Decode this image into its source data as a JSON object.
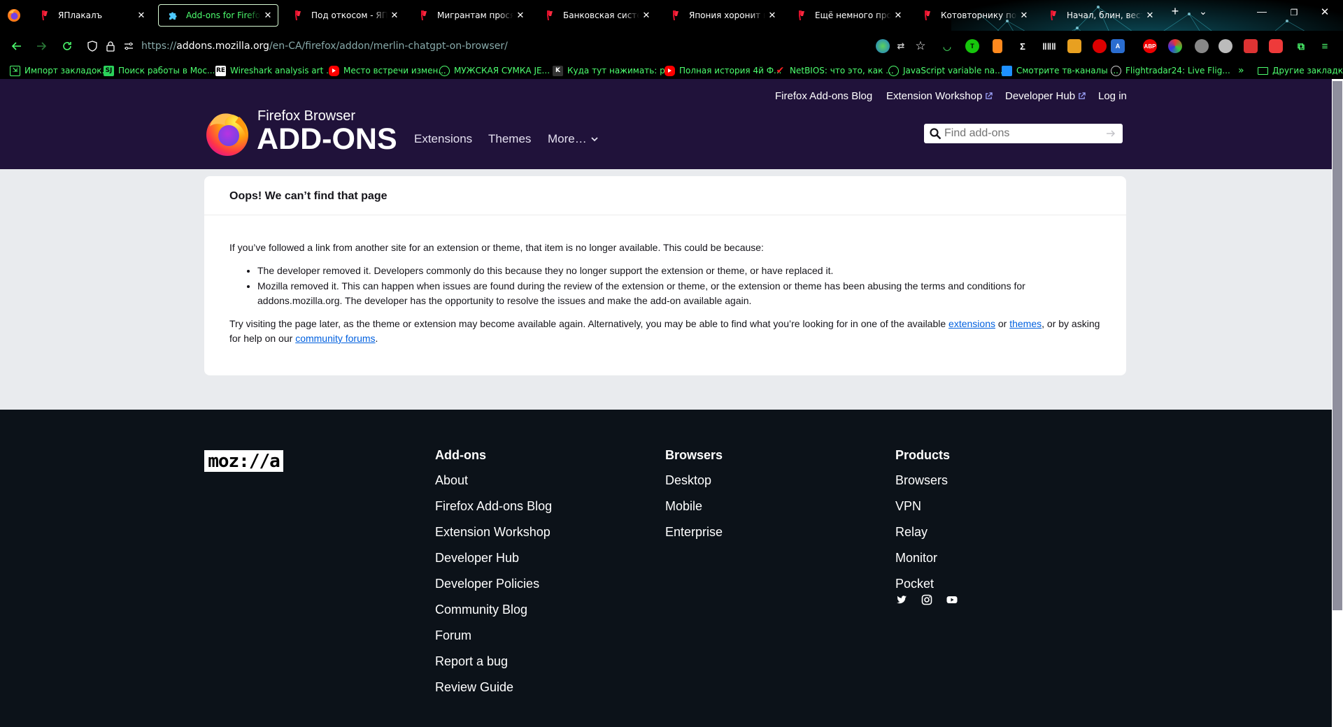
{
  "browser": {
    "tabs": [
      {
        "title": "ЯПлакалъ",
        "icon": "yaplakal-favicon"
      },
      {
        "title": "Add-ons for Firefox (en-CA)",
        "icon": "amo-puzzle-favicon",
        "active": true
      },
      {
        "title": "Под откосом - ЯПлакалъ",
        "icon": "yaplakal-favicon"
      },
      {
        "title": "Мигрантам просят разрешить",
        "icon": "yaplakal-favicon"
      },
      {
        "title": "Банковская система США",
        "icon": "yaplakal-favicon"
      },
      {
        "title": "Япония хоронит воспитание",
        "icon": "yaplakal-favicon"
      },
      {
        "title": "Ещё немного про Осаку",
        "icon": "yaplakal-favicon"
      },
      {
        "title": "Котовторнику посвящается",
        "icon": "yaplakal-favicon"
      },
      {
        "title": "Начал, блин, вести здоровый",
        "icon": "yaplakal-favicon"
      }
    ],
    "url_prefix": "https://",
    "url_host": "addons.mozilla.org",
    "url_path": "/en-CA/firefox/addon/merlin-chatgpt-on-browser/",
    "bookmarks": [
      {
        "label": "Импорт закладок...",
        "icon": "import-icon"
      },
      {
        "label": "Поиск работы в Мос...",
        "icon": "superjob-favicon",
        "glyph": "SJ"
      },
      {
        "label": "Wireshark analysis art ...",
        "icon": "wireshark-favicon",
        "glyph": "RE"
      },
      {
        "label": "Место встречи измен...",
        "icon": "youtube-favicon"
      },
      {
        "label": "МУЖСКАЯ СУМКА JE...",
        "icon": "globe-icon"
      },
      {
        "label": "Куда тут нажимать: р...",
        "icon": "k-favicon",
        "glyph": "K"
      },
      {
        "label": "Полная история 4й Ф...",
        "icon": "youtube-favicon"
      },
      {
        "label": "NetBIOS: что это, как ...",
        "icon": "checkmark-favicon"
      },
      {
        "label": "JavaScript variable na...",
        "icon": "globe-icon"
      },
      {
        "label": "Смотрите тв-каналы ...",
        "icon": "tv-favicon"
      },
      {
        "label": "Flightradar24: Live Flig...",
        "icon": "flightradar-favicon"
      }
    ],
    "other_bookmarks": "Другие закладки",
    "accent": "#4dff6f"
  },
  "header": {
    "top_links": {
      "blog": "Firefox Add-ons Blog",
      "workshop": "Extension Workshop",
      "devhub": "Developer Hub",
      "login": "Log in"
    },
    "brand_small": "Firefox Browser",
    "brand_big": "ADD-ONS",
    "nav": {
      "extensions": "Extensions",
      "themes": "Themes",
      "more": "More…"
    },
    "search_placeholder": "Find add-ons",
    "bg_color": "#20123a"
  },
  "error": {
    "title": "Oops! We can’t find that page",
    "intro": "If you’ve followed a link from another site for an extension or theme, that item is no longer available. This could be because:",
    "reasons": [
      "The developer removed it. Developers commonly do this because they no longer support the extension or theme, or have replaced it.",
      "Mozilla removed it. This can happen when issues are found during the review of the extension or theme, or the extension or theme has been abusing the terms and conditions for addons.mozilla.org. The developer has the opportunity to resolve the issues and make the add-on available again."
    ],
    "try_text_1": "Try visiting the page later, as the theme or extension may become available again. Alternatively, you may be able to find what you’re looking for in one of the available",
    "link_extensions": "extensions",
    "or": "or",
    "link_themes": "themes",
    "try_text_2": ", or by asking for help on our",
    "link_forums": "community forums",
    "period": "."
  },
  "footer": {
    "logo_text": "moz://a",
    "columns": [
      {
        "heading": "Add-ons",
        "links": [
          "About",
          "Firefox Add-ons Blog",
          "Extension Workshop",
          "Developer Hub",
          "Developer Policies",
          "Community Blog",
          "Forum",
          "Report a bug",
          "Review Guide"
        ]
      },
      {
        "heading": "Browsers",
        "links": [
          "Desktop",
          "Mobile",
          "Enterprise"
        ]
      },
      {
        "heading": "Products",
        "links": [
          "Browsers",
          "VPN",
          "Relay",
          "Monitor",
          "Pocket"
        ]
      }
    ],
    "social": [
      "twitter-icon",
      "instagram-icon",
      "youtube-icon"
    ]
  }
}
